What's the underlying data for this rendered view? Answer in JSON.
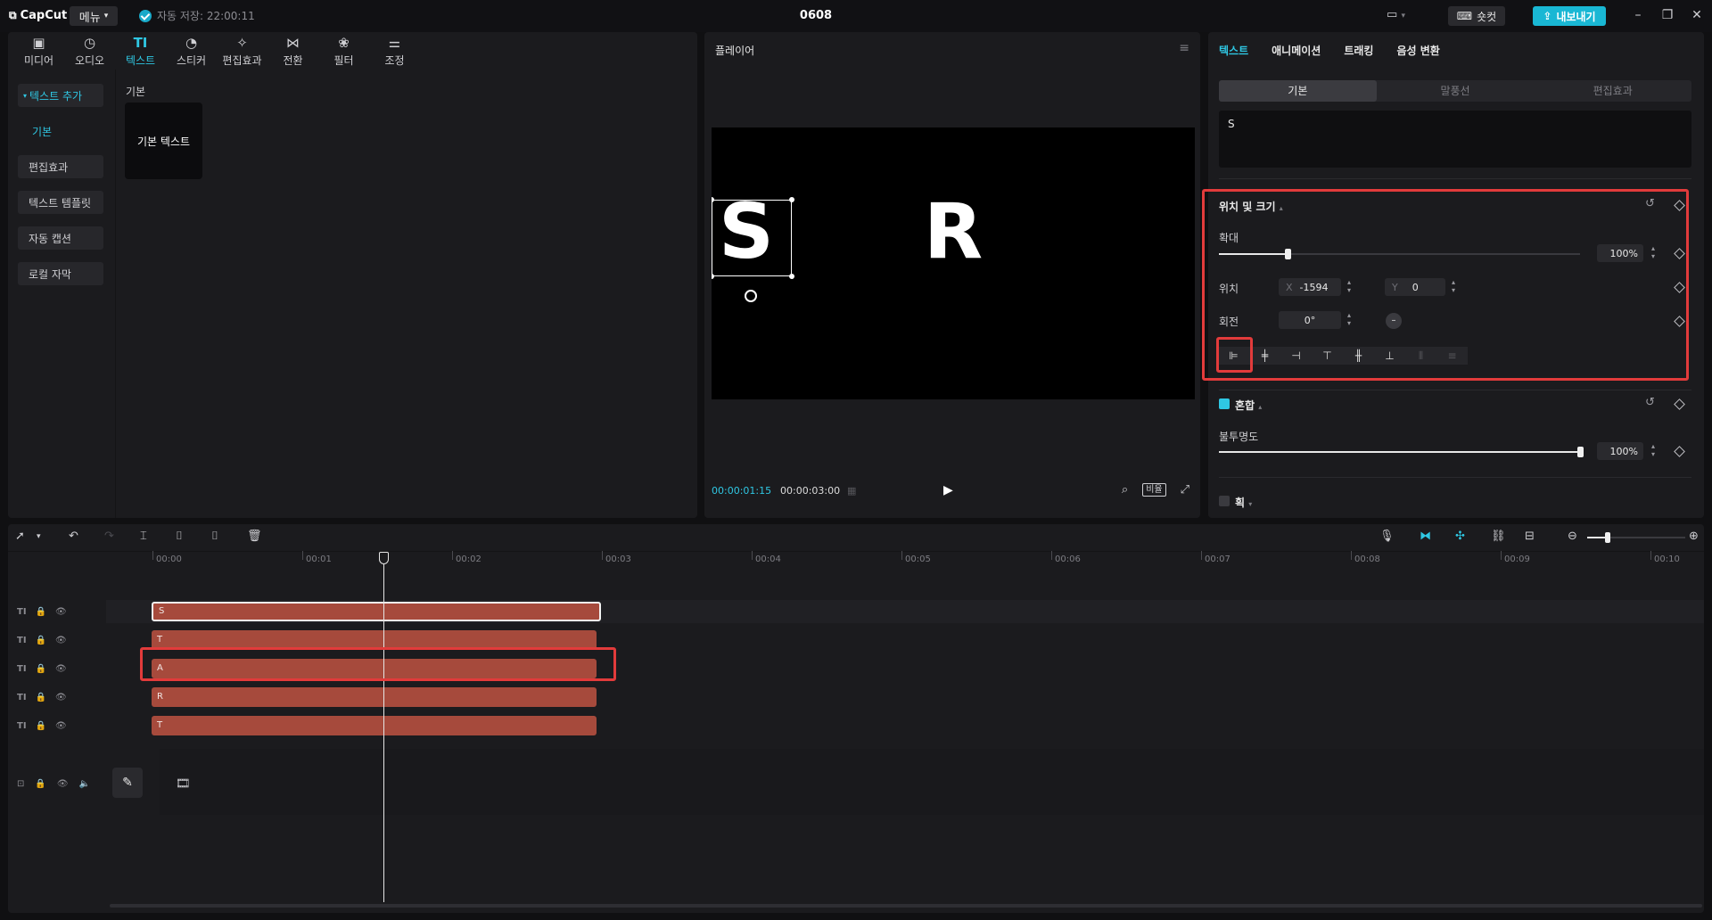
{
  "app": {
    "logo": "CapCut",
    "menu_label": "메뉴",
    "autosave": "자동 저장: 22:00:11",
    "project_title": "0608",
    "shortcut_label": "숏컷",
    "export_label": "내보내기"
  },
  "toolbar": {
    "tabs": [
      {
        "label": "미디어",
        "icon": "media-icon"
      },
      {
        "label": "오디오",
        "icon": "audio-icon"
      },
      {
        "label": "텍스트",
        "icon": "text-icon"
      },
      {
        "label": "스티커",
        "icon": "sticker-icon"
      },
      {
        "label": "편집효과",
        "icon": "effects-icon"
      },
      {
        "label": "전환",
        "icon": "transition-icon"
      },
      {
        "label": "필터",
        "icon": "filter-icon"
      },
      {
        "label": "조정",
        "icon": "adjust-icon"
      }
    ],
    "active_tab": "텍스트"
  },
  "side_nav": {
    "items": [
      "텍스트 추가",
      "기본",
      "편집효과",
      "텍스트 템플릿",
      "자동 캡션",
      "로컬 자막"
    ]
  },
  "library": {
    "section_label": "기본",
    "card_label": "기본 텍스트"
  },
  "player": {
    "title": "플레이어",
    "current_time": "00:00:01:15",
    "total_time": "00:00:03:00",
    "ratio_label": "비율",
    "preview_text_selected": "S",
    "preview_text_other": "R"
  },
  "properties": {
    "tabs": [
      "텍스트",
      "애니메이션",
      "트래킹",
      "음성 변환"
    ],
    "active_tab": "텍스트",
    "subtabs": [
      "기본",
      "말풍선",
      "편집효과"
    ],
    "active_subtab": "기본",
    "text_value": "S",
    "position_size": {
      "title": "위치 및 크기",
      "scale_label": "확대",
      "scale_value": "100%",
      "scale_fraction": 0.19,
      "position_label": "위치",
      "x_prefix": "X",
      "x_value": "-1594",
      "y_prefix": "Y",
      "y_value": "0",
      "rotation_label": "회전",
      "rotation_value": "0°"
    },
    "blend": {
      "title": "혼합",
      "opacity_label": "불투명도",
      "opacity_value": "100%",
      "opacity_fraction": 1.0
    },
    "stroke": {
      "title": "획"
    }
  },
  "timeline": {
    "ruler": [
      "00:00",
      "00:01",
      "00:02",
      "00:03",
      "00:04",
      "00:05",
      "00:06",
      "00:07",
      "00:08",
      "00:09",
      "00:10"
    ],
    "tracks": [
      {
        "label": "S",
        "selected": true
      },
      {
        "label": "T",
        "selected": false
      },
      {
        "label": "A",
        "selected": false
      },
      {
        "label": "R",
        "selected": false
      },
      {
        "label": "T",
        "selected": false
      }
    ]
  },
  "colors": {
    "accent": "#2fc7e3",
    "clip": "#a64a3c",
    "highlight_box": "#e23b3b"
  }
}
